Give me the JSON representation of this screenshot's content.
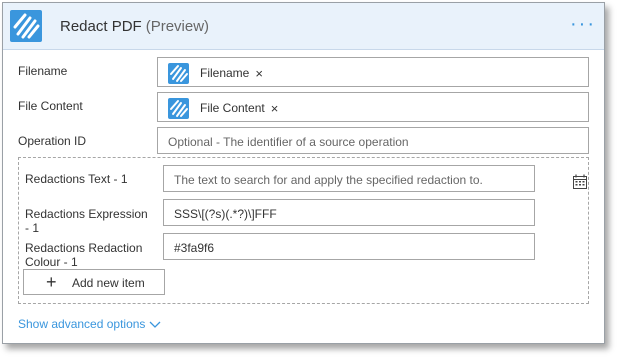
{
  "header": {
    "title": "Redact PDF",
    "subtitle": "(Preview)",
    "more_icon": "ellipsis-icon",
    "app_icon": "stripes-logo-icon",
    "accent": "#3a96dd"
  },
  "fields": {
    "filename": {
      "label": "Filename",
      "token": "Filename",
      "token_icon": "stripes-logo-icon",
      "remove": "×"
    },
    "file_content": {
      "label": "File Content",
      "token": "File Content",
      "token_icon": "stripes-logo-icon",
      "remove": "×"
    },
    "operation_id": {
      "label": "Operation ID",
      "placeholder": "Optional - The identifier of a source operation"
    }
  },
  "redactions": {
    "text": {
      "label": "Redactions Text - 1",
      "placeholder": "The text to search for and apply the specified redaction to."
    },
    "expression": {
      "label_line1": "Redactions Expression",
      "label_line2": "- 1",
      "value": "SSS\\[(?s)(.*?)\\]FFF"
    },
    "colour": {
      "label_line1": "Redactions Redaction",
      "label_line2": "Colour - 1",
      "value": "#3fa9f6"
    },
    "add_button": "Add new item",
    "dynamic_icon": "table-icon"
  },
  "footer": {
    "advanced": "Show advanced options"
  }
}
